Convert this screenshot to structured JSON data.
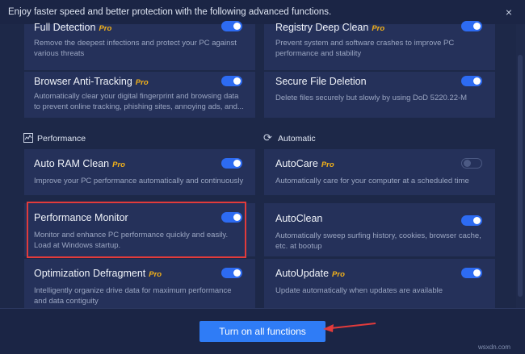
{
  "header": {
    "message": "Enjoy faster speed and better protection with the following advanced functions.",
    "close_icon": "×"
  },
  "pro_badge": "Pro",
  "cards": {
    "full_detection": {
      "title": "Full Detection",
      "desc": "Remove the deepest infections and protect your PC against various threats",
      "pro": true,
      "enabled": true
    },
    "registry_deep_clean": {
      "title": "Registry Deep Clean",
      "desc": "Prevent system and software crashes to improve PC performance and stability",
      "pro": true,
      "enabled": true
    },
    "browser_anti_tracking": {
      "title": "Browser Anti-Tracking",
      "desc": "Automatically clear your digital fingerprint and browsing data to prevent online tracking, phishing sites, annoying ads, and...",
      "pro": true,
      "enabled": true
    },
    "secure_file_deletion": {
      "title": "Secure File Deletion",
      "desc": "Delete files securely but slowly by using DoD 5220.22-M",
      "pro": false,
      "enabled": true
    },
    "auto_ram_clean": {
      "title": "Auto RAM Clean",
      "desc": "Improve your PC performance automatically and continuously",
      "pro": true,
      "enabled": true
    },
    "autocare": {
      "title": "AutoCare",
      "desc": "Automatically care for your computer at a scheduled time",
      "pro": true,
      "enabled": false
    },
    "performance_monitor": {
      "title": "Performance Monitor",
      "desc": "Monitor and enhance PC performance quickly and easily. Load at Windows startup.",
      "pro": false,
      "enabled": true
    },
    "autoclean": {
      "title": "AutoClean",
      "desc": "Automatically sweep surfing history, cookies, browser cache, etc. at bootup",
      "pro": false,
      "enabled": true
    },
    "optimization_defragment": {
      "title": "Optimization Defragment",
      "desc": "Intelligently organize drive data for maximum performance and data contiguity",
      "pro": true,
      "enabled": true
    },
    "autoupdate": {
      "title": "AutoUpdate",
      "desc": "Update automatically when updates are available",
      "pro": true,
      "enabled": true
    }
  },
  "sections": {
    "performance": "Performance",
    "automatic": "Automatic"
  },
  "footer": {
    "button_label": "Turn on all functions"
  },
  "watermark": "wsxdn.com",
  "colors": {
    "background": "#1d2848",
    "card": "#25315a",
    "accent": "#2f7cf6",
    "pro": "#f3b21a",
    "highlight": "#e23b3b"
  }
}
